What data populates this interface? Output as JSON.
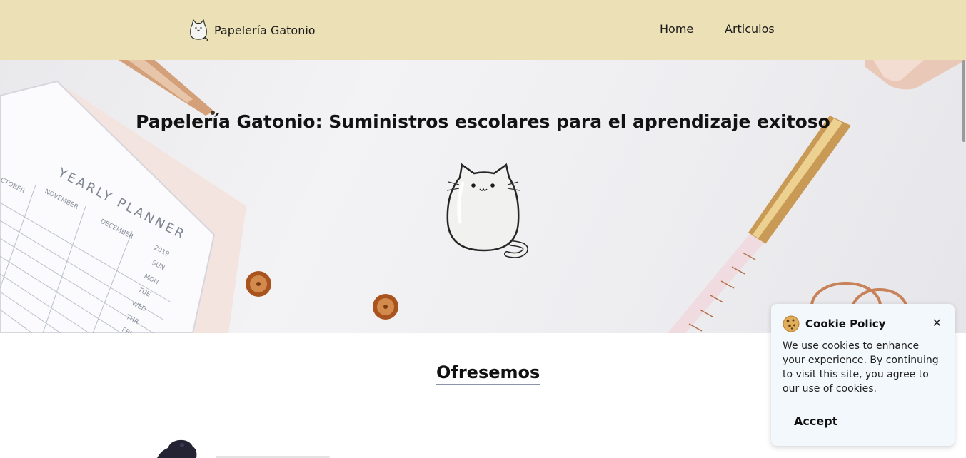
{
  "navbar": {
    "brand_name": "Papelería Gatonio",
    "links": [
      {
        "label": "Home"
      },
      {
        "label": "Articulos"
      }
    ]
  },
  "hero": {
    "title": "Papelería Gatonio: Suministros escolares para el aprendizaje exitoso",
    "planner_title": "YEARLY PLANNER",
    "planner_months": [
      "CTOBER",
      "NOVEMBER",
      "DECEMBER"
    ],
    "planner_year": "2019",
    "planner_days": [
      "SUN",
      "MON",
      "TUE",
      "WED",
      "THR",
      "FRI"
    ]
  },
  "section": {
    "title": "Ofresemos"
  },
  "cookie_banner": {
    "title": "Cookie Policy",
    "close_symbol": "✕",
    "text": "We use cookies to enhance your experience. By continuing to visit this site, you agree to our use of cookies.",
    "accept_label": "Accept"
  },
  "colors": {
    "navbar_bg": "#ebe0b6",
    "cookie_bg": "#f2f8fc",
    "heading_underline": "#8a96a8"
  },
  "icons": {
    "brand": "cat-logo-icon",
    "hero": "cat-illustration-icon",
    "cookie": "cookie-icon",
    "close": "close-icon"
  }
}
